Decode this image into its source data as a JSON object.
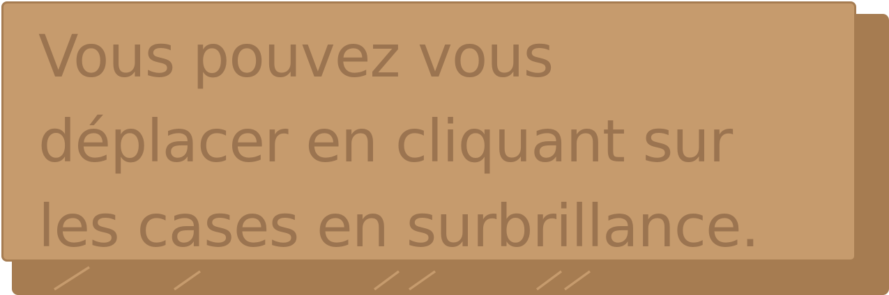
{
  "dialog": {
    "message": "Vous pouvez vous\ndéplacer en cliquant sur\nles cases en surbrillance."
  },
  "colors": {
    "panel_fill": "#c69b6d",
    "panel_shadow": "#a67c51",
    "text": "#9b7450"
  }
}
